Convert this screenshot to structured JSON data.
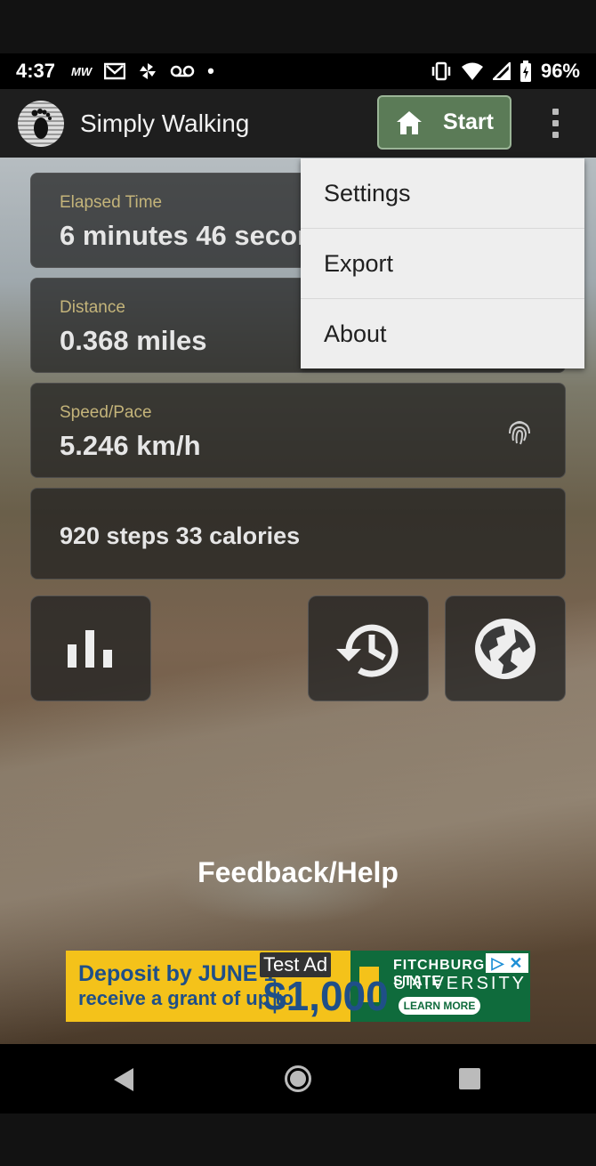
{
  "status_bar": {
    "time": "4:37",
    "notification_icons": [
      "mw-icon",
      "gmail-icon",
      "pinwheel-icon",
      "voicemail-icon",
      "dot-icon"
    ],
    "battery": "96%"
  },
  "app_bar": {
    "title": "Simply Walking",
    "start_label": "Start"
  },
  "stats": {
    "elapsed": {
      "label": "Elapsed Time",
      "value": "6 minutes 46 seconds"
    },
    "distance": {
      "label": "Distance",
      "value": "0.368 miles"
    },
    "speed": {
      "label": "Speed/Pace",
      "value": "5.246 km/h"
    },
    "steps_calories": "920 steps  33 calories"
  },
  "buttons": [
    "bar-chart-icon",
    "history-icon",
    "globe-icon"
  ],
  "feedback_label": "Feedback/Help",
  "menu": {
    "items": [
      "Settings",
      "Export",
      "About"
    ]
  },
  "ad": {
    "tag": "Test Ad",
    "line1": "Deposit by JUNE 1",
    "line2": "receive a grant of up to",
    "amount": "$1,000",
    "university_line1": "FITCHBURG STATE",
    "university_line2": "UNIVERSITY",
    "cta": "LEARN MORE"
  },
  "colors": {
    "start_button": "#5b7b57",
    "label_gold": "#c4b47a",
    "menu_bg": "#eeeeee"
  }
}
